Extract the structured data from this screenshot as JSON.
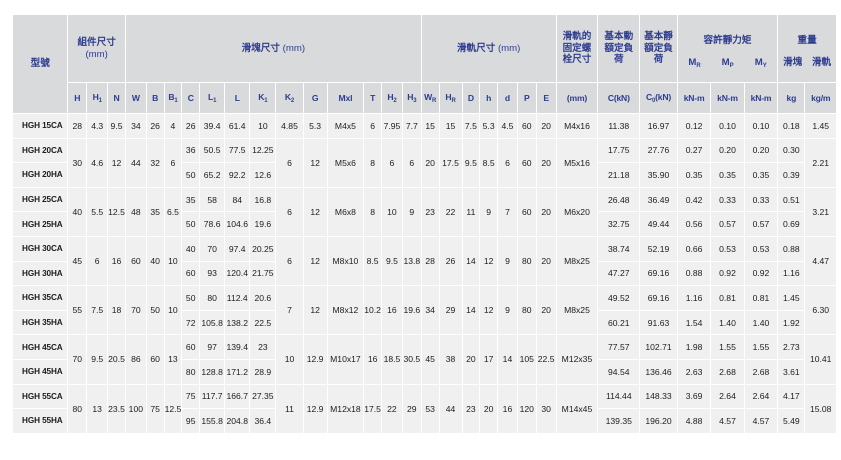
{
  "headers": {
    "model": "型號",
    "assembly": "組件尺寸",
    "block": "滑塊尺寸",
    "rail": "滑軌尺寸",
    "unit_mm": "(mm)",
    "rail_bolt": "滑軌的固定螺栓尺寸",
    "dyn_load": "基本動額定負荷",
    "stat_load": "基本靜額定負荷",
    "moment": "容許靜力矩",
    "weight": "重量",
    "block_w": "滑塊",
    "rail_w": "滑軌",
    "mr": "M",
    "mp": "M",
    "my": "M",
    "mr_sub": "R",
    "mp_sub": "P",
    "my_sub": "Y",
    "mm": "(mm)",
    "c_kn": "C(kN)",
    "c0_kn": "C",
    "c0_sub": "0",
    "c0_unit": "(kN)",
    "knm": "kN-m",
    "kg": "kg",
    "kgm": "kg/m",
    "cols": {
      "H": "H",
      "H1": "H",
      "N": "N",
      "W": "W",
      "B": "B",
      "B1": "B",
      "C": "C",
      "L1": "L",
      "L": "L",
      "K1": "K",
      "K2": "K",
      "G": "G",
      "Mxl": "Mxl",
      "T": "T",
      "H2": "H",
      "H3": "H",
      "WR": "W",
      "HR": "H",
      "D": "D",
      "h": "h",
      "d": "d",
      "P": "P",
      "E": "E"
    },
    "subs": {
      "H1": "1",
      "B1": "1",
      "L1": "1",
      "K1": "1",
      "K2": "2",
      "H2": "2",
      "H3": "3",
      "WR": "R",
      "HR": "R"
    }
  },
  "rows": [
    {
      "model": "HGH 15CA",
      "H": "28",
      "H1": "4.3",
      "N": "9.5",
      "W": "34",
      "B": "26",
      "B1": "4",
      "C": "26",
      "L1": "39.4",
      "L": "61.4",
      "K1": "10",
      "K2": "4.85",
      "G": "5.3",
      "Mxl": "M4x5",
      "T": "6",
      "H2": "7.95",
      "H3": "7.7",
      "WR": "15",
      "HR": "15",
      "D": "7.5",
      "h": "5.3",
      "d": "4.5",
      "P": "60",
      "E": "20",
      "bolt": "M4x16",
      "C_kN": "11.38",
      "C0": "16.97",
      "MR": "0.12",
      "MP": "0.10",
      "MY": "0.10",
      "wblock": "0.18",
      "wrail": "1.45"
    },
    {
      "model": "HGH 20CA",
      "C": "36",
      "L1": "50.5",
      "L": "77.5",
      "K1": "12.25",
      "C_kN": "17.75",
      "C0": "27.76",
      "MR": "0.27",
      "MP": "0.20",
      "MY": "0.20",
      "wblock": "0.30"
    },
    {
      "model": "HGH 20HA",
      "C": "50",
      "L1": "65.2",
      "L": "92.2",
      "K1": "12.6",
      "C_kN": "21.18",
      "C0": "35.90",
      "MR": "0.35",
      "MP": "0.35",
      "MY": "0.35",
      "wblock": "0.39"
    },
    {
      "model": "HGH 25CA",
      "C": "35",
      "L1": "58",
      "L": "84",
      "K1": "16.8",
      "C_kN": "26.48",
      "C0": "36.49",
      "MR": "0.42",
      "MP": "0.33",
      "MY": "0.33",
      "wblock": "0.51"
    },
    {
      "model": "HGH 25HA",
      "C": "50",
      "L1": "78.6",
      "L": "104.6",
      "K1": "19.6",
      "C_kN": "32.75",
      "C0": "49.44",
      "MR": "0.56",
      "MP": "0.57",
      "MY": "0.57",
      "wblock": "0.69"
    },
    {
      "model": "HGH 30CA",
      "C": "40",
      "L1": "70",
      "L": "97.4",
      "K1": "20.25",
      "C_kN": "38.74",
      "C0": "52.19",
      "MR": "0.66",
      "MP": "0.53",
      "MY": "0.53",
      "wblock": "0.88"
    },
    {
      "model": "HGH 30HA",
      "C": "60",
      "L1": "93",
      "L": "120.4",
      "K1": "21.75",
      "C_kN": "47.27",
      "C0": "69.16",
      "MR": "0.88",
      "MP": "0.92",
      "MY": "0.92",
      "wblock": "1.16"
    },
    {
      "model": "HGH 35CA",
      "C": "50",
      "L1": "80",
      "L": "112.4",
      "K1": "20.6",
      "C_kN": "49.52",
      "C0": "69.16",
      "MR": "1.16",
      "MP": "0.81",
      "MY": "0.81",
      "wblock": "1.45"
    },
    {
      "model": "HGH 35HA",
      "C": "72",
      "L1": "105.8",
      "L": "138.2",
      "K1": "22.5",
      "C_kN": "60.21",
      "C0": "91.63",
      "MR": "1.54",
      "MP": "1.40",
      "MY": "1.40",
      "wblock": "1.92"
    },
    {
      "model": "HGH 45CA",
      "C": "60",
      "L1": "97",
      "L": "139.4",
      "K1": "23",
      "C_kN": "77.57",
      "C0": "102.71",
      "MR": "1.98",
      "MP": "1.55",
      "MY": "1.55",
      "wblock": "2.73"
    },
    {
      "model": "HGH 45HA",
      "C": "80",
      "L1": "128.8",
      "L": "171.2",
      "K1": "28.9",
      "C_kN": "94.54",
      "C0": "136.46",
      "MR": "2.63",
      "MP": "2.68",
      "MY": "2.68",
      "wblock": "3.61"
    },
    {
      "model": "HGH 55CA",
      "C": "75",
      "L1": "117.7",
      "L": "166.7",
      "K1": "27.35",
      "C_kN": "114.44",
      "C0": "148.33",
      "MR": "3.69",
      "MP": "2.64",
      "MY": "2.64",
      "wblock": "4.17"
    },
    {
      "model": "HGH 55HA",
      "C": "95",
      "L1": "155.8",
      "L": "204.8",
      "K1": "36.4",
      "C_kN": "139.35",
      "C0": "196.20",
      "MR": "4.88",
      "MP": "4.57",
      "MY": "4.57",
      "wblock": "5.49"
    }
  ],
  "groups": [
    {
      "H": "30",
      "H1": "4.6",
      "N": "12",
      "W": "44",
      "B": "32",
      "B1": "6",
      "K2": "6",
      "G": "12",
      "Mxl": "M5x6",
      "T": "8",
      "H2": "6",
      "H3": "6",
      "WR": "20",
      "HR": "17.5",
      "D": "9.5",
      "h": "8.5",
      "d": "6",
      "P": "60",
      "E": "20",
      "bolt": "M5x16",
      "wrail": "2.21"
    },
    {
      "H": "40",
      "H1": "5.5",
      "N": "12.5",
      "W": "48",
      "B": "35",
      "B1": "6.5",
      "K2": "6",
      "G": "12",
      "Mxl": "M6x8",
      "T": "8",
      "H2": "10",
      "H3": "9",
      "WR": "23",
      "HR": "22",
      "D": "11",
      "h": "9",
      "d": "7",
      "P": "60",
      "E": "20",
      "bolt": "M6x20",
      "wrail": "3.21"
    },
    {
      "H": "45",
      "H1": "6",
      "N": "16",
      "W": "60",
      "B": "40",
      "B1": "10",
      "K2": "6",
      "G": "12",
      "Mxl": "M8x10",
      "T": "8.5",
      "H2": "9.5",
      "H3": "13.8",
      "WR": "28",
      "HR": "26",
      "D": "14",
      "h": "12",
      "d": "9",
      "P": "80",
      "E": "20",
      "bolt": "M8x25",
      "wrail": "4.47"
    },
    {
      "H": "55",
      "H1": "7.5",
      "N": "18",
      "W": "70",
      "B": "50",
      "B1": "10",
      "K2": "7",
      "G": "12",
      "Mxl": "M8x12",
      "T": "10.2",
      "H2": "16",
      "H3": "19.6",
      "WR": "34",
      "HR": "29",
      "D": "14",
      "h": "12",
      "d": "9",
      "P": "80",
      "E": "20",
      "bolt": "M8x25",
      "wrail": "6.30"
    },
    {
      "H": "70",
      "H1": "9.5",
      "N": "20.5",
      "W": "86",
      "B": "60",
      "B1": "13",
      "K2": "10",
      "G": "12.9",
      "Mxl": "M10x17",
      "T": "16",
      "H2": "18.5",
      "H3": "30.5",
      "WR": "45",
      "HR": "38",
      "D": "20",
      "h": "17",
      "d": "14",
      "P": "105",
      "E": "22.5",
      "bolt": "M12x35",
      "wrail": "10.41"
    },
    {
      "H": "80",
      "H1": "13",
      "N": "23.5",
      "W": "100",
      "B": "75",
      "B1": "12.5",
      "K2": "11",
      "G": "12.9",
      "Mxl": "M12x18",
      "T": "17.5",
      "H2": "22",
      "H3": "29",
      "WR": "53",
      "HR": "44",
      "D": "23",
      "h": "20",
      "d": "16",
      "P": "120",
      "E": "30",
      "bolt": "M14x45",
      "wrail": "15.08"
    }
  ]
}
